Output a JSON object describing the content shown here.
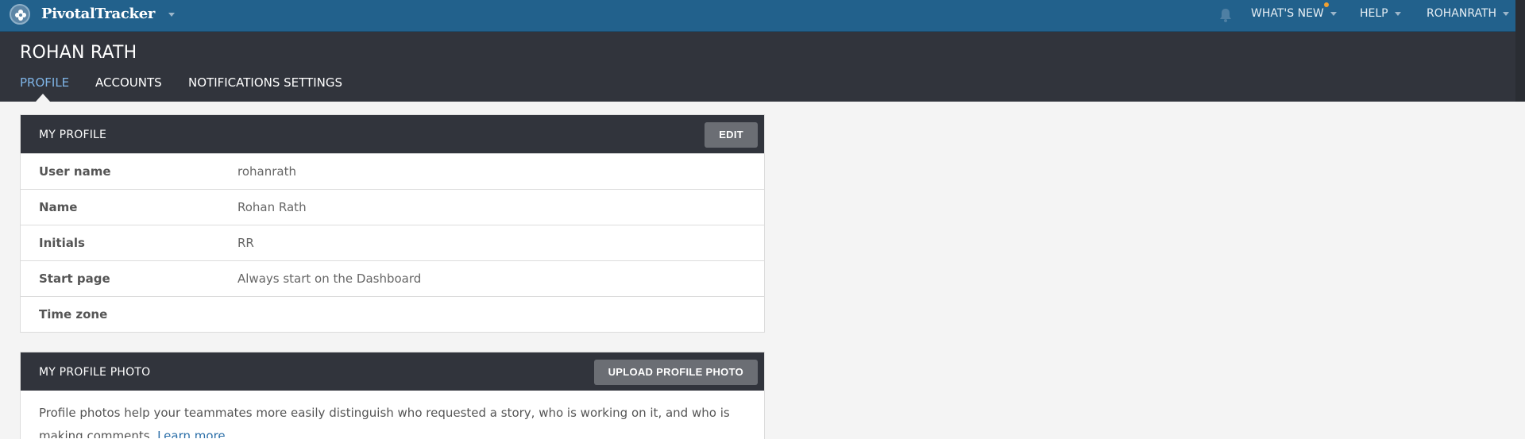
{
  "topbar": {
    "brand": "PivotalTracker",
    "nav": [
      {
        "label": "WHAT'S NEW"
      },
      {
        "label": "HELP"
      },
      {
        "label": "ROHANRATH"
      }
    ],
    "icons": [
      "pivotal-logo-icon",
      "chevron-down-icon",
      "bell-icon"
    ]
  },
  "header": {
    "title": "ROHAN RATH",
    "tabs": [
      {
        "label": "PROFILE",
        "active": true
      },
      {
        "label": "ACCOUNTS",
        "active": false
      },
      {
        "label": "NOTIFICATIONS SETTINGS",
        "active": false
      }
    ]
  },
  "profile": {
    "title": "MY PROFILE",
    "edit_label": "EDIT",
    "rows": [
      {
        "label": "User name",
        "value": "rohanrath"
      },
      {
        "label": "Name",
        "value": "Rohan Rath"
      },
      {
        "label": "Initials",
        "value": "RR"
      },
      {
        "label": "Start page",
        "value": "Always start on the Dashboard"
      },
      {
        "label": "Time zone",
        "value": ""
      }
    ]
  },
  "photo": {
    "title": "MY PROFILE PHOTO",
    "upload_label": "UPLOAD PROFILE PHOTO",
    "description": "Profile photos help your teammates more easily distinguish who requested a story, who is working on it, and who is making comments.",
    "learn_more": "Learn more"
  },
  "colors": {
    "topbar": "#22618c",
    "header": "#31343c",
    "active_tab": "#7fb4e6",
    "link": "#2c6fa8",
    "notification_dot": "#f0a030"
  }
}
